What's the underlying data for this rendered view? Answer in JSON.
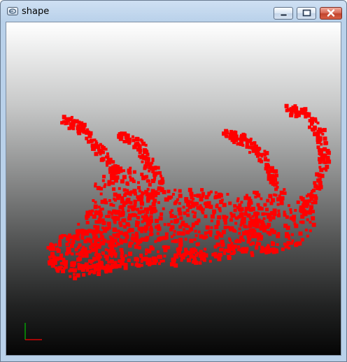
{
  "window": {
    "title": "shape",
    "app_icon": "opengl-window-icon",
    "controls": {
      "minimize_icon": "minimize-icon",
      "maximize_icon": "maximize-icon",
      "close_icon": "close-icon"
    }
  },
  "scene": {
    "point_color": "#ff0000",
    "background_top": "#ffffff",
    "background_bottom": "#050505",
    "axis_x_color": "#ff0000",
    "axis_y_color": "#00c000"
  }
}
